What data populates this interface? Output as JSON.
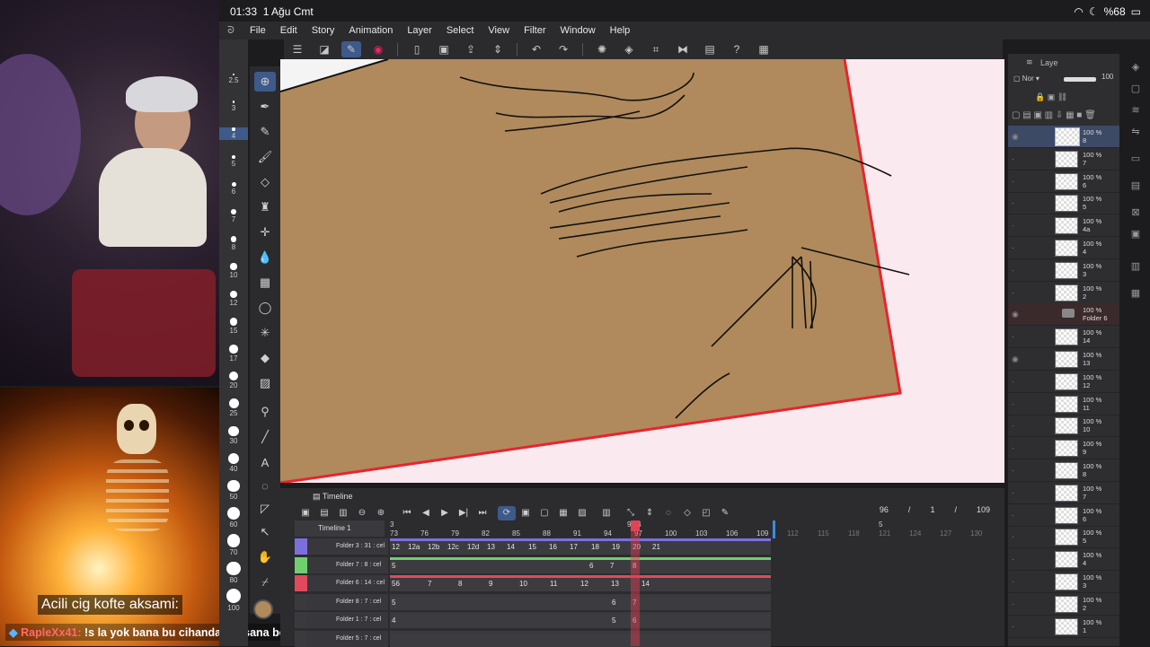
{
  "status": {
    "time": "01:33",
    "date": "1 Ağu Cmt",
    "battery": "%68"
  },
  "menu": [
    "File",
    "Edit",
    "Story",
    "Animation",
    "Layer",
    "Select",
    "View",
    "Filter",
    "Window",
    "Help"
  ],
  "brush_sizes": [
    "2.5",
    "3",
    "4",
    "5",
    "6",
    "7",
    "8",
    "10",
    "12",
    "15",
    "17",
    "20",
    "25",
    "30",
    "40",
    "50",
    "60",
    "70",
    "80",
    "100"
  ],
  "layers_panel": {
    "header_label": "Laye",
    "opacity_header": "100",
    "layers": [
      {
        "opacity": "100 %",
        "name": "8",
        "selected": true
      },
      {
        "opacity": "100 %",
        "name": "7"
      },
      {
        "opacity": "100 %",
        "name": "6"
      },
      {
        "opacity": "100 %",
        "name": "5"
      },
      {
        "opacity": "100 %",
        "name": "4a"
      },
      {
        "opacity": "100 %",
        "name": "4"
      },
      {
        "opacity": "100 %",
        "name": "3"
      },
      {
        "opacity": "100 %",
        "name": "2"
      },
      {
        "opacity": "100 %",
        "name": "Folder 6",
        "folder": true
      },
      {
        "opacity": "100 %",
        "name": "14"
      },
      {
        "opacity": "100 %",
        "name": "13"
      },
      {
        "opacity": "100 %",
        "name": "12"
      },
      {
        "opacity": "100 %",
        "name": "11"
      },
      {
        "opacity": "100 %",
        "name": "10"
      },
      {
        "opacity": "100 %",
        "name": "9"
      },
      {
        "opacity": "100 %",
        "name": "8"
      },
      {
        "opacity": "100 %",
        "name": "7"
      },
      {
        "opacity": "100 %",
        "name": "6"
      },
      {
        "opacity": "100 %",
        "name": "5"
      },
      {
        "opacity": "100 %",
        "name": "4"
      },
      {
        "opacity": "100 %",
        "name": "3"
      },
      {
        "opacity": "100 %",
        "name": "2"
      },
      {
        "opacity": "100 %",
        "name": "1"
      }
    ]
  },
  "timeline": {
    "title": "Timeline",
    "name": "Timeline 1",
    "current_frame": "96",
    "frame_sep": "/",
    "page": "1",
    "total": "109",
    "ruler": [
      "73",
      "76",
      "79",
      "82",
      "85",
      "88",
      "91",
      "94",
      "97",
      "100",
      "103",
      "106",
      "109",
      "112",
      "115",
      "118",
      "121",
      "124",
      "127",
      "130"
    ],
    "ruler_top": {
      "left": "3",
      "playhead": "96 4",
      "right": "5"
    },
    "tracks": [
      {
        "label": "Folder 3 : 31 : cel",
        "color": "#7b6fe0",
        "cels": [
          "12",
          "12a",
          "12b",
          "12c",
          "12d",
          "13",
          "14",
          "15",
          "16",
          "17",
          "18",
          "19",
          "20",
          "21"
        ]
      },
      {
        "label": "Folder 7 : 8 : cel",
        "color": "#6fcf6f",
        "cels": [
          "5",
          "6",
          "7",
          "8"
        ]
      },
      {
        "label": "Folder 6 : 14 : cel",
        "color": "#e04a5a",
        "cels": [
          "56",
          "7",
          "8",
          "9",
          "10",
          "11",
          "12",
          "13",
          "14"
        ]
      },
      {
        "label": "Folder 8 : 7 : cel",
        "color": "#3a3a3e",
        "cels": [
          "5",
          "6",
          "7"
        ]
      },
      {
        "label": "Folder 1 : 7 : cel",
        "color": "#3a3a3e",
        "cels": [
          "4",
          "5",
          "6"
        ]
      },
      {
        "label": "Folder 5 : 7 : cel",
        "color": "#3a3a3e",
        "cels": []
      }
    ]
  },
  "overlay": {
    "meme_caption": "Acili cig kofte aksami:",
    "chat_user": "RapleXx41:",
    "chat_message": "!s la yok bana bu cihandan açsana bekir"
  }
}
